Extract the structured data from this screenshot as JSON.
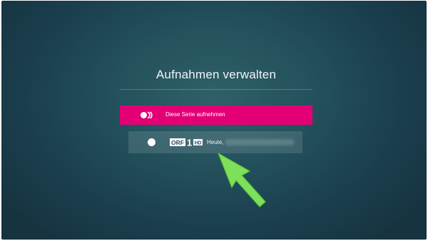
{
  "dialog": {
    "title": "Aufnahmen verwalten"
  },
  "options": {
    "series": {
      "label": "Diese Serie aufnehmen",
      "icon": "series-record-icon"
    },
    "episode": {
      "channel_logo": "ORF 1 HD",
      "channel_logo_parts": {
        "name": "ORF",
        "number": "1",
        "suffix": "HD"
      },
      "label": "Heute,",
      "icon": "record-dot-icon"
    }
  },
  "annotation": {
    "icon": "arrow-pointer-icon"
  },
  "colors": {
    "accent": "#e20074",
    "arrow": "#7ee05a",
    "background": "#1e4756"
  }
}
